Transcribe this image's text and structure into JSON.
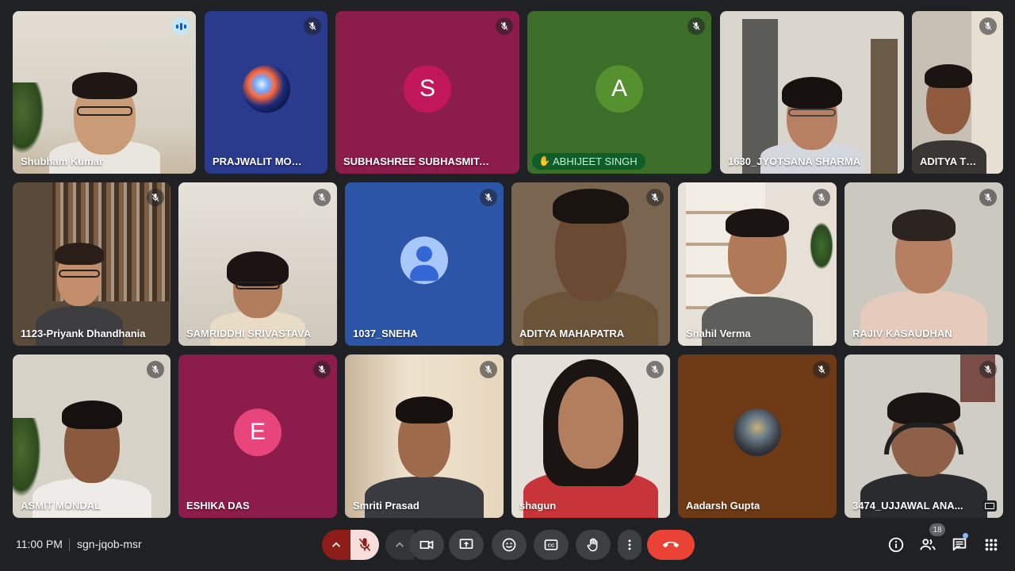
{
  "participants": [
    {
      "name": "Shubham Kumar",
      "status": "speaking"
    },
    {
      "name": "PRAJWALIT MOH...",
      "status": "muted"
    },
    {
      "name": "SUBHASHREE SUBHASMITA BE...",
      "initial": "S",
      "status": "muted"
    },
    {
      "name": "ABHIJEET SINGH",
      "initial": "A",
      "status": "muted",
      "hand_raised": true
    },
    {
      "name": "1630_JYOTSANA SHARMA",
      "status": "video"
    },
    {
      "name": "ADITYA THA...",
      "status": "muted"
    },
    {
      "name": "1123-Priyank Dhandhania",
      "status": "muted"
    },
    {
      "name": "SAMRIDDHI SRIVASTAVA",
      "status": "muted"
    },
    {
      "name": "1037_SNEHA",
      "status": "muted"
    },
    {
      "name": "ADITYA MAHAPATRA",
      "status": "muted"
    },
    {
      "name": "Shahil Verma",
      "status": "muted"
    },
    {
      "name": "RAJIV KASAUDHAN",
      "status": "muted"
    },
    {
      "name": "ASMIT MONDAL",
      "status": "muted"
    },
    {
      "name": "ESHIKA DAS",
      "initial": "E",
      "status": "muted"
    },
    {
      "name": "Smriti Prasad",
      "status": "muted"
    },
    {
      "name": "shagun",
      "status": "muted"
    },
    {
      "name": "Aadarsh Gupta",
      "status": "muted"
    },
    {
      "name": "3474_UJJAWAL ANA...",
      "status": "muted"
    }
  ],
  "meeting": {
    "time": "11:00 PM",
    "code": "sgn-jqob-msr"
  },
  "people_count": "18",
  "colors": {
    "mic_off_red": "#ea4335",
    "end_call_red": "#ea4335",
    "speaking_outline": "#a8c7fa",
    "background": "#202124"
  },
  "icons": [
    "chevron-up-icon",
    "mic-off-icon",
    "videocam-icon",
    "present-screen-icon",
    "emoji-icon",
    "captions-icon",
    "raise-hand-icon",
    "more-vert-icon",
    "call-end-icon",
    "info-icon",
    "people-icon",
    "chat-icon",
    "activities-icon"
  ]
}
